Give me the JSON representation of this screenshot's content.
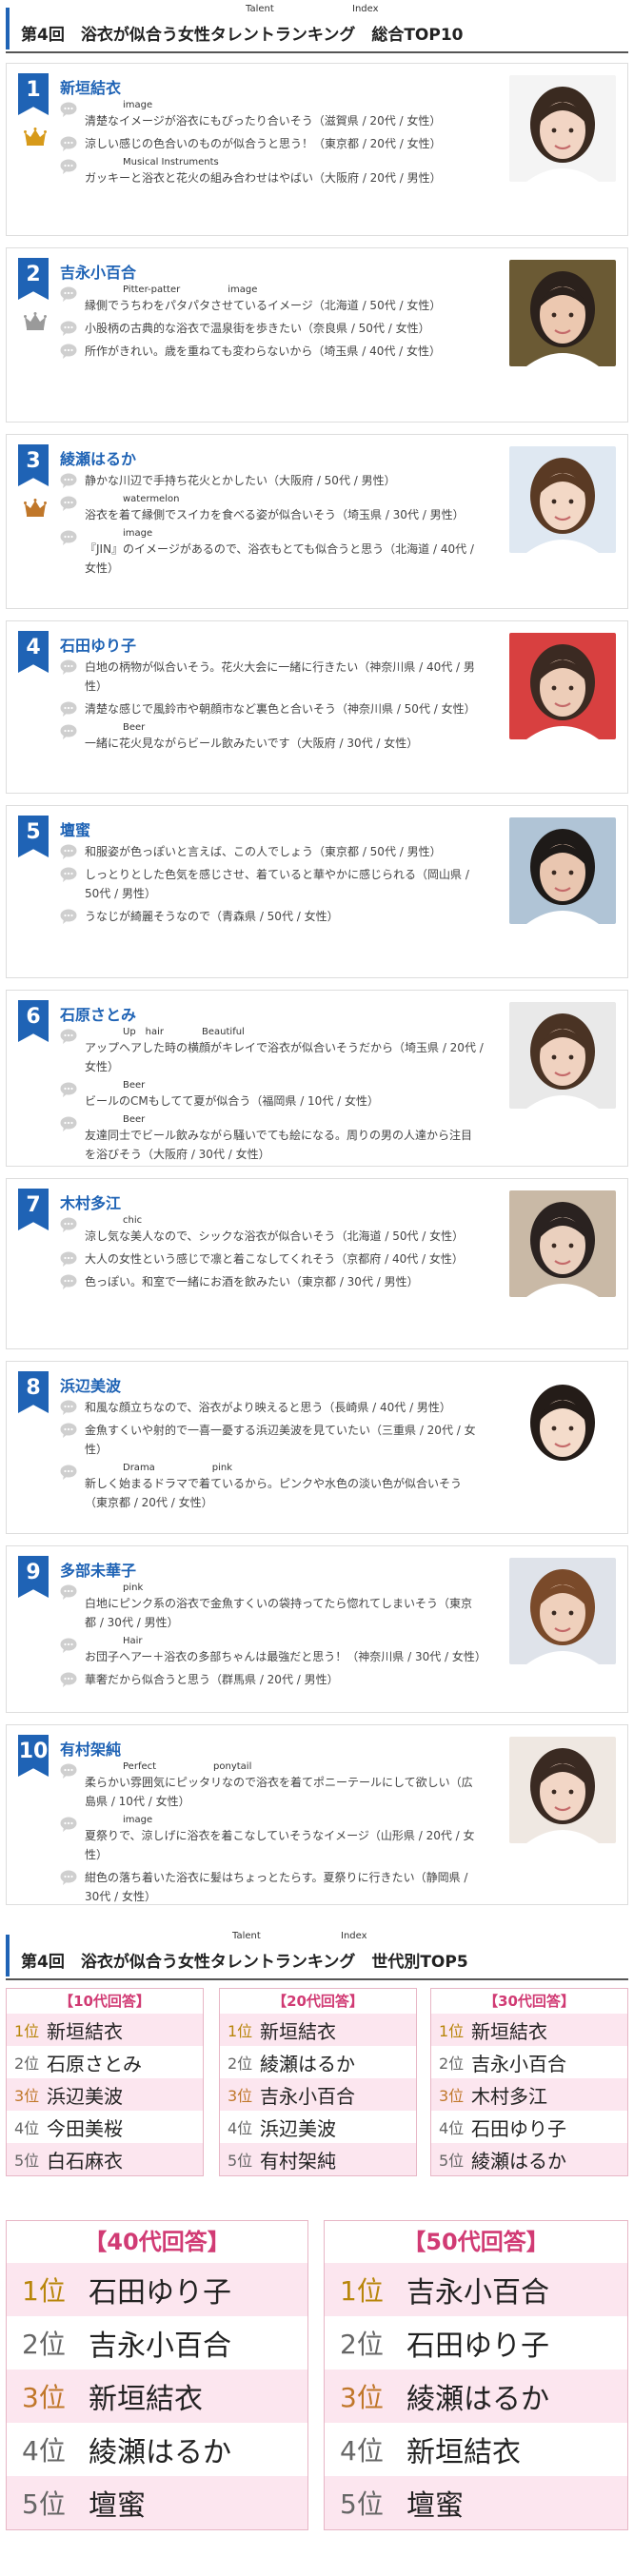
{
  "section1": {
    "ruby_talent": "Talent",
    "ruby_index": "Index",
    "title": "第4回　浴衣が似合う女性タレントランキング　総合TOP10"
  },
  "rankings": [
    {
      "rank": "1",
      "name": "新垣結衣",
      "crown": "gold",
      "comments": [
        {
          "ruby": "image",
          "text": "清楚なイメージが浴衣にもぴったり合いそう（滋賀県 / 20代 / 女性）"
        },
        {
          "ruby": "",
          "text": "涼しい感じの色合いのものが似合うと思う！（東京都 / 20代 / 女性）"
        },
        {
          "ruby": "Musical Instruments",
          "text": "ガッキーと浴衣と花火の組み合わせはやばい（大阪府 / 20代 / 男性）"
        }
      ]
    },
    {
      "rank": "2",
      "name": "吉永小百合",
      "crown": "silver",
      "comments": [
        {
          "ruby": "Pitter-patter　　　　　image",
          "text": "縁側でうちわをパタパタさせているイメージ（北海道 / 50代 / 女性）"
        },
        {
          "ruby": "",
          "text": "小股柄の古典的な浴衣で温泉街を歩きたい（奈良県 / 50代 / 女性）"
        },
        {
          "ruby": "",
          "text": "所作がきれい。歳を重ねても変わらないから（埼玉県 / 40代 / 女性）"
        }
      ]
    },
    {
      "rank": "3",
      "name": "綾瀬はるか",
      "crown": "bronze",
      "comments": [
        {
          "ruby": "",
          "text": "静かな川辺で手持ち花火とかしたい（大阪府 / 50代 / 男性）"
        },
        {
          "ruby": "watermelon",
          "text": "浴衣を着て縁側でスイカを食べる姿が似合いそう（埼玉県 / 30代 / 男性）"
        },
        {
          "ruby": "image",
          "text": "『JIN』のイメージがあるので、浴衣もとても似合うと思う（北海道 / 40代 / 女性）"
        }
      ]
    },
    {
      "rank": "4",
      "name": "石田ゆり子",
      "crown": "",
      "comments": [
        {
          "ruby": "",
          "text": "白地の柄物が似合いそう。花火大会に一緒に行きたい（神奈川県 / 40代 / 男性）"
        },
        {
          "ruby": "",
          "text": "清楚な感じで風鈴市や朝顔市など裏色と合いそう（神奈川県 / 50代 / 女性）"
        },
        {
          "ruby": "Beer",
          "text": "一緒に花火見ながらビール飲みたいです（大阪府 / 30代 / 女性）"
        }
      ]
    },
    {
      "rank": "5",
      "name": "壇蜜",
      "crown": "",
      "comments": [
        {
          "ruby": "",
          "text": "和服姿が色っぽいと言えば、この人でしょう（東京都 / 50代 / 男性）"
        },
        {
          "ruby": "",
          "text": "しっとりとした色気を感じさせ、着ていると華やかに感じられる（岡山県 / 50代 / 男性）"
        },
        {
          "ruby": "",
          "text": "うなじが綺麗そうなので（青森県 / 50代 / 女性）"
        }
      ]
    },
    {
      "rank": "6",
      "name": "石原さとみ",
      "crown": "",
      "comments": [
        {
          "ruby": "Up　hair　　　　Beautiful",
          "text": "アップヘアした時の横顔がキレイで浴衣が似合いそうだから（埼玉県 / 20代 / 女性）"
        },
        {
          "ruby": "Beer",
          "text": "ビールのCMもしてて夏が似合う（福岡県 / 10代 / 女性）"
        },
        {
          "ruby": "Beer",
          "text": "友達同士でビール飲みながら騒いでても絵になる。周りの男の人達から注目を浴びそう（大阪府 / 30代 / 女性）"
        }
      ]
    },
    {
      "rank": "7",
      "name": "木村多江",
      "crown": "",
      "comments": [
        {
          "ruby": "chic",
          "text": "涼し気な美人なので、シックな浴衣が似合いそう（北海道 / 50代 / 女性）"
        },
        {
          "ruby": "",
          "text": "大人の女性という感じで凛と着こなしてくれそう（京都府 / 40代 / 女性）"
        },
        {
          "ruby": "",
          "text": "色っぽい。和室で一緒にお酒を飲みたい（東京都 / 30代 / 男性）"
        }
      ]
    },
    {
      "rank": "8",
      "name": "浜辺美波",
      "crown": "",
      "comments": [
        {
          "ruby": "",
          "text": "和風な顔立ちなので、浴衣がより映えると思う（長崎県 / 40代 / 男性）"
        },
        {
          "ruby": "",
          "text": "金魚すくいや射的で一喜一憂する浜辺美波を見ていたい（三重県 / 20代 / 女性）"
        },
        {
          "ruby": "Drama　　　　　　pink",
          "text": "新しく始まるドラマで着ているから。ピンクや水色の淡い色が似合いそう（東京都 / 20代 / 女性）"
        }
      ]
    },
    {
      "rank": "9",
      "name": "多部未華子",
      "crown": "",
      "comments": [
        {
          "ruby": "pink",
          "text": "白地にピンク系の浴衣で金魚すくいの袋持ってたら惚れてしまいそう（東京都 / 30代 / 男性）"
        },
        {
          "ruby": "Hair",
          "text": "お団子ヘアー＋浴衣の多部ちゃんは最強だと思う！（神奈川県 / 30代 / 女性）"
        },
        {
          "ruby": "",
          "text": "華奢だから似合うと思う（群馬県 / 20代 / 男性）"
        }
      ]
    },
    {
      "rank": "10",
      "name": "有村架純",
      "crown": "",
      "comments": [
        {
          "ruby": "Perfect　　　　　　ponytail",
          "text": "柔らかい雰囲気にピッタリなので浴衣を着てポニーテールにして欲しい（広島県 / 10代 / 女性）"
        },
        {
          "ruby": "image",
          "text": "夏祭りで、涼しげに浴衣を着こなしていそうなイメージ（山形県 / 20代 / 女性）"
        },
        {
          "ruby": "",
          "text": "紺色の落ち着いた浴衣に髪はちょっとたらす。夏祭りに行きたい（静岡県 / 30代 / 女性）"
        }
      ]
    }
  ],
  "section2": {
    "ruby_talent": "Talent",
    "ruby_index": "Index",
    "title": "第4回　浴衣が似合う女性タレントランキング　世代別TOP5"
  },
  "generations": [
    {
      "title": "【10代回答】",
      "rows": [
        {
          "rank": "1位",
          "name": "新垣結衣"
        },
        {
          "rank": "2位",
          "name": "石原さとみ"
        },
        {
          "rank": "3位",
          "name": "浜辺美波"
        },
        {
          "rank": "4位",
          "name": "今田美桜"
        },
        {
          "rank": "5位",
          "name": "白石麻衣"
        }
      ]
    },
    {
      "title": "【20代回答】",
      "rows": [
        {
          "rank": "1位",
          "name": "新垣結衣"
        },
        {
          "rank": "2位",
          "name": "綾瀬はるか"
        },
        {
          "rank": "3位",
          "name": "吉永小百合"
        },
        {
          "rank": "4位",
          "name": "浜辺美波"
        },
        {
          "rank": "5位",
          "name": "有村架純"
        }
      ]
    },
    {
      "title": "【30代回答】",
      "rows": [
        {
          "rank": "1位",
          "name": "新垣結衣"
        },
        {
          "rank": "2位",
          "name": "吉永小百合"
        },
        {
          "rank": "3位",
          "name": "木村多江"
        },
        {
          "rank": "4位",
          "name": "石田ゆり子"
        },
        {
          "rank": "5位",
          "name": "綾瀬はるか"
        }
      ]
    },
    {
      "title": "【40代回答】",
      "rows": [
        {
          "rank": "1位",
          "name": "石田ゆり子"
        },
        {
          "rank": "2位",
          "name": "吉永小百合"
        },
        {
          "rank": "3位",
          "name": "新垣結衣"
        },
        {
          "rank": "4位",
          "name": "綾瀬はるか"
        },
        {
          "rank": "5位",
          "name": "壇蜜"
        }
      ]
    },
    {
      "title": "【50代回答】",
      "rows": [
        {
          "rank": "1位",
          "name": "吉永小百合"
        },
        {
          "rank": "2位",
          "name": "石田ゆり子"
        },
        {
          "rank": "3位",
          "name": "綾瀬はるか"
        },
        {
          "rank": "4位",
          "name": "新垣結衣"
        },
        {
          "rank": "5位",
          "name": "壇蜜"
        }
      ]
    }
  ],
  "colors": {
    "accent_blue": "#1f63b5",
    "pink_title": "#d13b74",
    "pink_row": "#fce6ef",
    "gold": "#d79a1a",
    "silver": "#9a9a9a",
    "bronze": "#c0772a"
  }
}
